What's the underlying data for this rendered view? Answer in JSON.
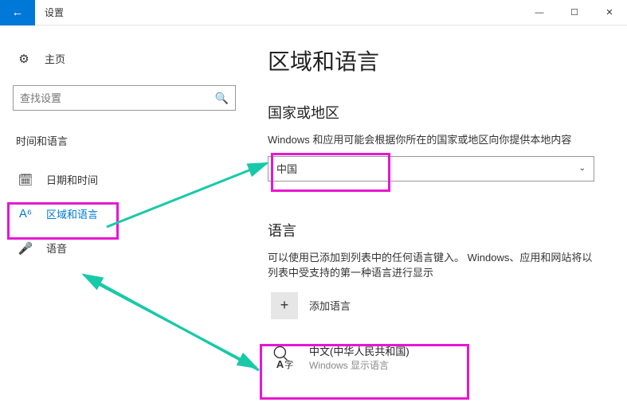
{
  "title": "设置",
  "winControls": {
    "min": "—",
    "max": "☐",
    "close": "✕"
  },
  "sidebar": {
    "home": "主页",
    "searchPlaceholder": "查找设置",
    "section": "时间和语言",
    "items": [
      {
        "icon": "calendar-icon",
        "glyph": "🗓",
        "label": "日期和时间"
      },
      {
        "icon": "globe-a-icon",
        "glyph": "A⁶",
        "label": "区域和语言",
        "selected": true
      },
      {
        "icon": "mic-icon",
        "glyph": "🎤",
        "label": "语音"
      }
    ]
  },
  "main": {
    "heading": "区域和语言",
    "region": {
      "title": "国家或地区",
      "desc": "Windows 和应用可能会根据你所在的国家或地区向你提供本地内容",
      "selected": "中国"
    },
    "language": {
      "title": "语言",
      "desc": "可以使用已添加到列表中的任何语言键入。 Windows、应用和网站将以列表中受支持的第一种语言进行显示",
      "addLabel": "添加语言",
      "items": [
        {
          "name": "中文(中华人民共和国)",
          "sub": "Windows 显示语言"
        }
      ]
    }
  }
}
